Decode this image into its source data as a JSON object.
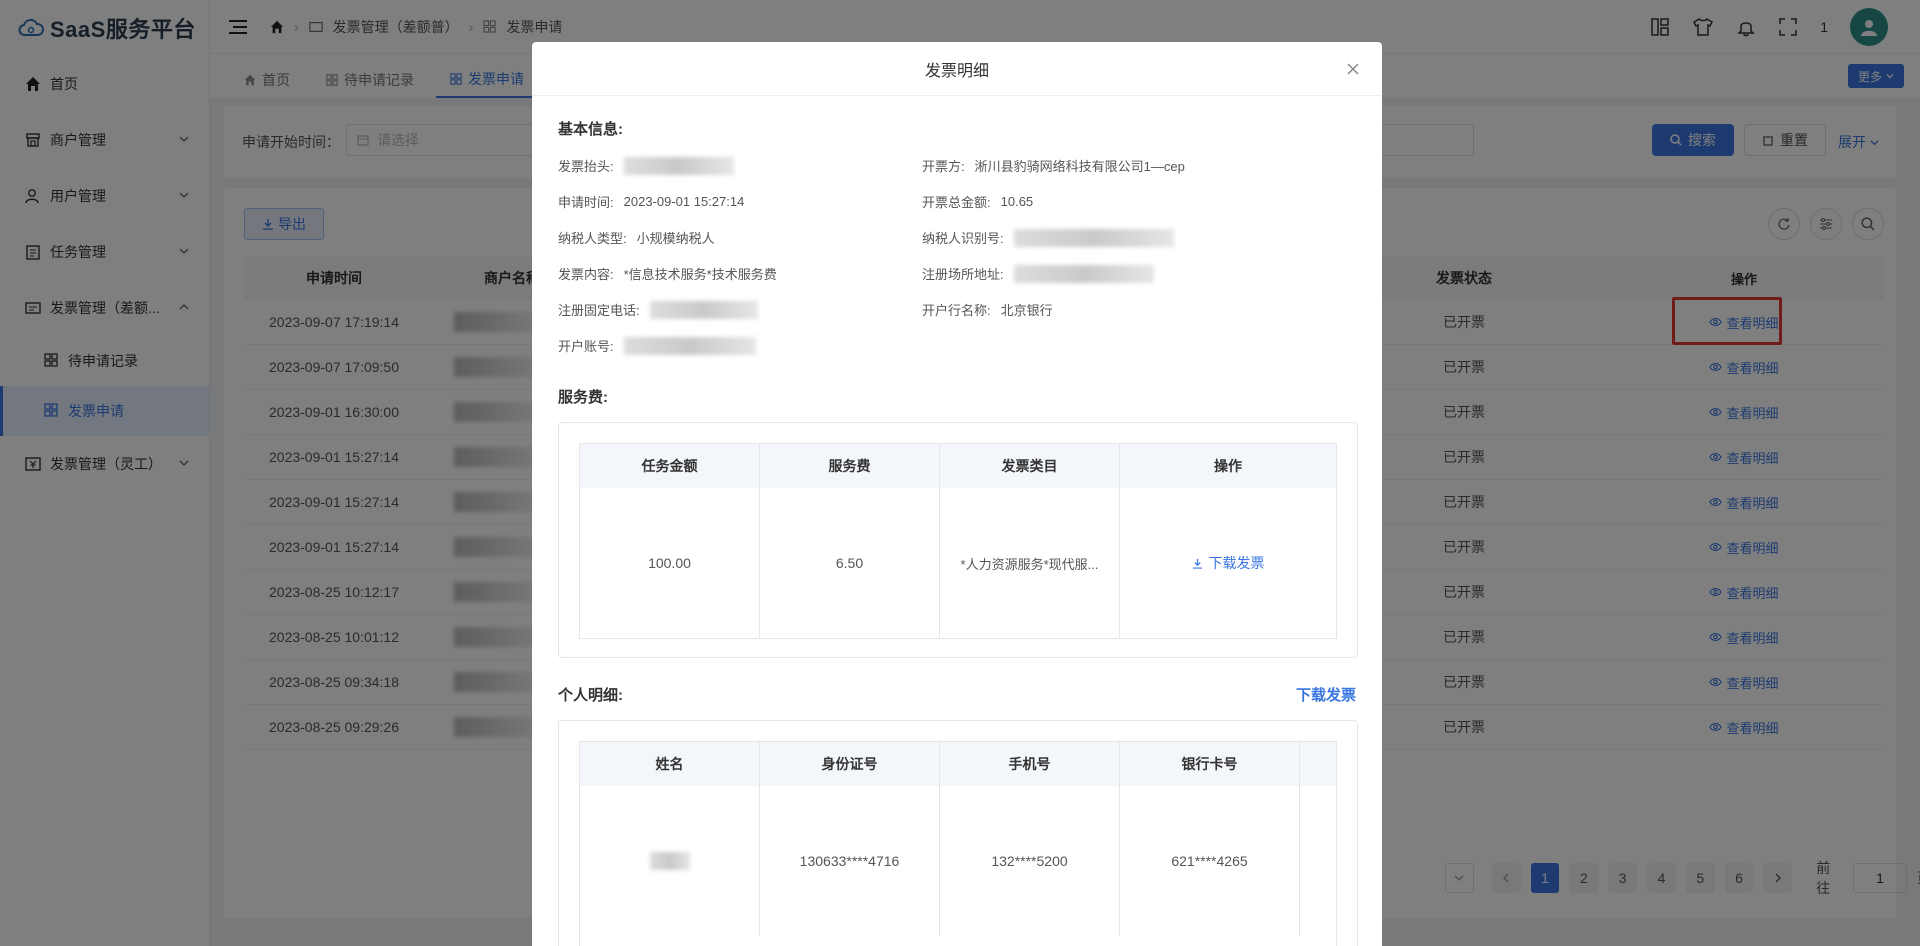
{
  "brand": {
    "name": "SaaS服务平台"
  },
  "sidebar": {
    "items": [
      {
        "label": "首页"
      },
      {
        "label": "商户管理"
      },
      {
        "label": "用户管理"
      },
      {
        "label": "任务管理"
      },
      {
        "label": "发票管理（差额..."
      },
      {
        "label": "发票管理（灵工）"
      }
    ],
    "subitems": [
      {
        "label": "待申请记录"
      },
      {
        "label": "发票申请"
      }
    ]
  },
  "header": {
    "breadcrumb": [
      "发票管理（差额普）",
      "发票申请"
    ],
    "badge": "1"
  },
  "tabs": [
    {
      "label": "首页"
    },
    {
      "label": "待申请记录"
    },
    {
      "label": "发票申请"
    }
  ],
  "more_label": "更多",
  "search": {
    "label": "申请开始时间：",
    "placeholder": "请选择",
    "search_label": "搜索",
    "reset_label": "重置",
    "expand_label": "展开"
  },
  "table": {
    "export_label": "导出",
    "headers": {
      "time": "申请时间",
      "merchant": "商户名称",
      "status": "发票状态",
      "op": "操作"
    },
    "rows": [
      {
        "time": "2023-09-07 17:19:14",
        "status": "已开票",
        "op": "查看明细"
      },
      {
        "time": "2023-09-07 17:09:50",
        "status": "已开票",
        "op": "查看明细"
      },
      {
        "time": "2023-09-01 16:30:00",
        "status": "已开票",
        "op": "查看明细"
      },
      {
        "time": "2023-09-01 15:27:14",
        "status": "已开票",
        "op": "查看明细"
      },
      {
        "time": "2023-09-01 15:27:14",
        "status": "已开票",
        "op": "查看明细"
      },
      {
        "time": "2023-09-01 15:27:14",
        "status": "已开票",
        "op": "查看明细"
      },
      {
        "time": "2023-08-25 10:12:17",
        "status": "已开票",
        "op": "查看明细"
      },
      {
        "time": "2023-08-25 10:01:12",
        "status": "已开票",
        "op": "查看明细"
      },
      {
        "time": "2023-08-25 09:34:18",
        "status": "已开票",
        "op": "查看明细"
      },
      {
        "time": "2023-08-25 09:29:26",
        "status": "已开票",
        "op": "查看明细"
      }
    ]
  },
  "pager": {
    "pages": [
      "1",
      "2",
      "3",
      "4",
      "5",
      "6"
    ],
    "goto_label": "前往",
    "goto_value": "1",
    "page_suffix": "页"
  },
  "modal": {
    "title": "发票明细",
    "basic_title": "基本信息:",
    "fields": {
      "title_label": "发票抬头:",
      "issuer_label": "开票方:",
      "issuer_value": "淅川县豹骑网络科技有限公司1—cep",
      "apply_time_label": "申请时间:",
      "apply_time_value": "2023-09-01 15:27:14",
      "total_label": "开票总金额:",
      "total_value": "10.65",
      "taxpayer_type_label": "纳税人类型:",
      "taxpayer_type_value": "小规模纳税人",
      "taxpayer_id_label": "纳税人识别号:",
      "content_label": "发票内容:",
      "content_value": "*信息技术服务*技术服务费",
      "address_label": "注册场所地址:",
      "phone_label": "注册固定电话:",
      "bank_label": "开户行名称:",
      "bank_value": "北京银行",
      "account_label": "开户账号:"
    },
    "service_title": "服务费:",
    "service_table": {
      "headers": [
        "任务金额",
        "服务费",
        "发票类目",
        "操作"
      ],
      "row": {
        "amount": "100.00",
        "fee": "6.50",
        "category": "*人力资源服务*现代服...",
        "op": "下载发票"
      }
    },
    "personal_title": "个人明细:",
    "personal_download": "下载发票",
    "personal_table": {
      "headers": [
        "姓名",
        "身份证号",
        "手机号",
        "银行卡号"
      ],
      "row": {
        "id": "130633****4716",
        "phone": "132****5200",
        "card": "621****4265"
      }
    }
  }
}
